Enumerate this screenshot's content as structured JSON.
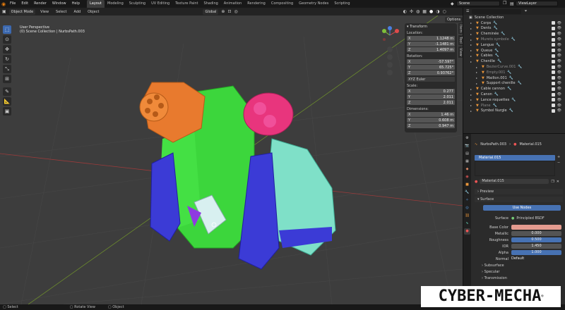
{
  "topbar": {
    "menus": [
      "File",
      "Edit",
      "Render",
      "Window",
      "Help"
    ],
    "workspaces": [
      "Layout",
      "Modeling",
      "Sculpting",
      "UV Editing",
      "Texture Paint",
      "Shading",
      "Animation",
      "Rendering",
      "Compositing",
      "Geometry Nodes",
      "Scripting"
    ],
    "active_workspace": "Layout",
    "scene": "Scene",
    "view_layer": "ViewLayer"
  },
  "viewport_header": {
    "mode": "Object Mode",
    "menus": [
      "View",
      "Select",
      "Add",
      "Object"
    ],
    "orientation": "Global",
    "options": "Options"
  },
  "viewport": {
    "info_line1": "User Perspective",
    "info_line2": "(0) Scene Collection | NurbsPath.003"
  },
  "npanel": {
    "title": "Transform",
    "location_label": "Location:",
    "location": {
      "x": "1.1248 m",
      "y": "-1.1481 m",
      "z": "1.4097 m"
    },
    "rotation_label": "Rotation:",
    "rotation": {
      "x": "-57.597°",
      "y": "65.725°",
      "z": "0.93762°"
    },
    "rotation_mode": "XYZ Euler",
    "scale_label": "Scale:",
    "scale": {
      "x": "0.277",
      "y": "2.011",
      "z": "2.011"
    },
    "dimensions_label": "Dimensions:",
    "dimensions": {
      "x": "1.46 m",
      "y": "0.608 m",
      "z": "0.947 m"
    },
    "tabs": [
      "Item",
      "Tool",
      "View"
    ]
  },
  "outliner": {
    "root": "Scene Collection",
    "items": [
      {
        "label": "Corps",
        "indent": 1,
        "dim": false
      },
      {
        "label": "Dents",
        "indent": 1,
        "dim": false
      },
      {
        "label": "Cheminée",
        "indent": 1,
        "dim": false
      },
      {
        "label": "Murets symbole",
        "indent": 1,
        "dim": true
      },
      {
        "label": "Langue",
        "indent": 1,
        "dim": false
      },
      {
        "label": "Queue",
        "indent": 1,
        "dim": false
      },
      {
        "label": "Cables",
        "indent": 1,
        "dim": false
      },
      {
        "label": "Chenille",
        "indent": 1,
        "dim": false
      },
      {
        "label": "BezierCurve.001",
        "indent": 2,
        "dim": true
      },
      {
        "label": "Empty.001",
        "indent": 2,
        "dim": true
      },
      {
        "label": "Maillon.001",
        "indent": 2,
        "dim": false
      },
      {
        "label": "Support chenille",
        "indent": 2,
        "dim": false
      },
      {
        "label": "Cable cannon",
        "indent": 1,
        "dim": false
      },
      {
        "label": "Canon",
        "indent": 1,
        "dim": false
      },
      {
        "label": "Lance roquettes",
        "indent": 1,
        "dim": false
      },
      {
        "label": "Plane",
        "indent": 1,
        "dim": true
      },
      {
        "label": "Symbol Nurgle",
        "indent": 1,
        "dim": false
      }
    ]
  },
  "properties": {
    "breadcrumb_object": "NurbsPath.003",
    "breadcrumb_material": "Material.015",
    "slot": "Material.015",
    "material_name": "Material.015",
    "preview_label": "Preview",
    "surface_label": "Surface",
    "use_nodes": "Use Nodes",
    "surface_field_label": "Surface",
    "surface_shader": "Principled BSDF",
    "rows": [
      {
        "label": "Base Color",
        "value": "",
        "type": "color"
      },
      {
        "label": "Metallic",
        "value": "0.000",
        "type": "num"
      },
      {
        "label": "Roughness",
        "value": "0.500",
        "type": "bar"
      },
      {
        "label": "IOR",
        "value": "1.450",
        "type": "num"
      },
      {
        "label": "Alpha",
        "value": "1.000",
        "type": "bar"
      },
      {
        "label": "Normal",
        "value": "Default",
        "type": "text"
      }
    ],
    "subsurface_label": "Subsurface",
    "specular_label": "Specular",
    "transmission_label": "Transmission"
  },
  "status": {
    "select": "Select",
    "rotate": "Rotate View",
    "object": "Object"
  },
  "watermark": "CYBER-MECHA",
  "colors": {
    "accent": "#e87d0d",
    "selected_blue": "#4772b3",
    "base_color_swatch": "#e49b8f"
  }
}
